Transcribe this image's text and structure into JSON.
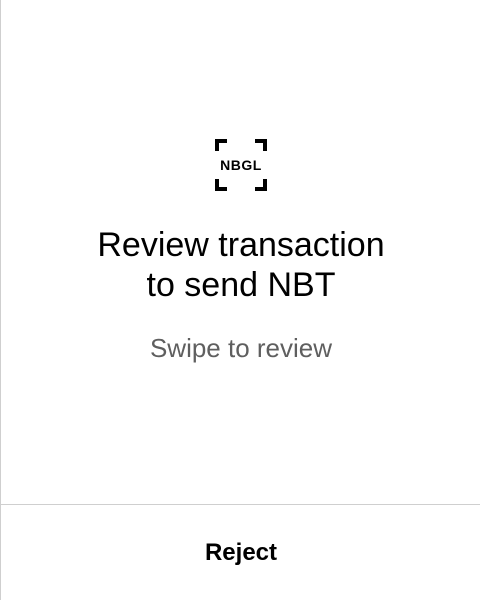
{
  "review": {
    "logo_text": "NBGL",
    "title_line1": "Review transaction",
    "title_line2": "to send NBT",
    "subtitle": "Swipe to review"
  },
  "footer": {
    "reject_label": "Reject"
  },
  "colors": {
    "text_primary": "#000000",
    "text_secondary": "#5f5f5f",
    "divider": "#cfcfcf",
    "background": "#ffffff"
  }
}
